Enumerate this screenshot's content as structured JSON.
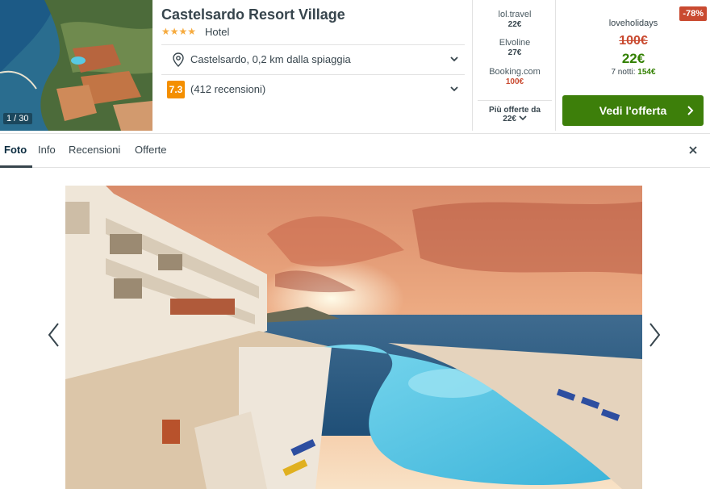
{
  "hotel": {
    "name": "Castelsardo Resort Village",
    "stars": "★★★★",
    "type": "Hotel",
    "image_counter": "1 / 30",
    "location": "Castelsardo, 0,2 km dalla spiaggia",
    "rating": "7.3",
    "reviews": "(412 recensioni)"
  },
  "offers": [
    {
      "provider": "lol.travel",
      "price": "22€"
    },
    {
      "provider": "Elvoline",
      "price": "27€"
    },
    {
      "provider": "Booking.com",
      "price": "100€"
    }
  ],
  "more_offers": {
    "label": "Più offerte da",
    "price": "22€"
  },
  "deal": {
    "discount": "-78%",
    "provider": "loveholidays",
    "old_price": "100€",
    "new_price": "22€",
    "nights_label": "7 notti:",
    "nights_price": "154€",
    "cta": "Vedi l'offerta"
  },
  "tabs": [
    "Foto",
    "Info",
    "Recensioni",
    "Offerte"
  ],
  "colors": {
    "accent_green": "#328000",
    "cta_green": "#3d7f0a",
    "discount_red": "#c94a30",
    "rating_orange": "#f48f00",
    "star_yellow": "#f6ab3f"
  }
}
